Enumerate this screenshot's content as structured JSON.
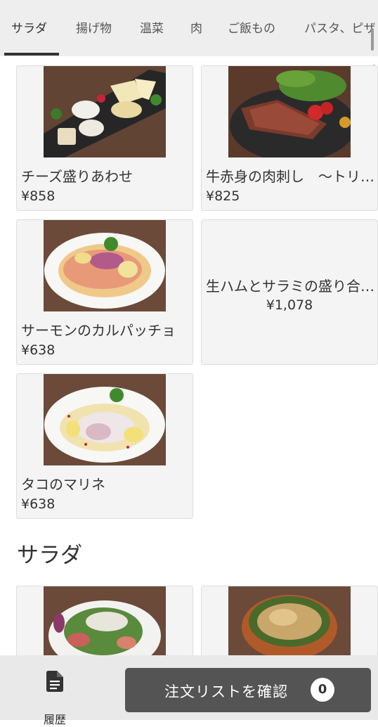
{
  "tabs": [
    {
      "label": "サラダ",
      "active": true
    },
    {
      "label": "揚げ物",
      "active": false
    },
    {
      "label": "温菜",
      "active": false
    },
    {
      "label": "肉",
      "active": false
    },
    {
      "label": "ご飯もの",
      "active": false
    },
    {
      "label": "パスタ、ピザ",
      "active": false
    }
  ],
  "items": [
    {
      "name": "チーズ盛りあわせ",
      "price": "¥858",
      "image": "cheese-plate"
    },
    {
      "name": "牛赤身の肉刺し　〜トリュフソース〜",
      "price": "¥825",
      "image": "beef-tataki"
    },
    {
      "name": "サーモンのカルパッチョ",
      "price": "¥638",
      "image": "salmon-carpaccio"
    },
    {
      "name": "生ハムとサラミの盛り合わせ",
      "price": "¥1,078",
      "image": null
    },
    {
      "name": "タコのマリネ",
      "price": "¥638",
      "image": "octopus-marinade"
    }
  ],
  "section": {
    "title": "サラダ"
  },
  "footer": {
    "history_label": "履歴",
    "order_label": "注文リストを確認",
    "order_count": "0"
  },
  "colors": {
    "tabbar_bg": "#eeeeee",
    "card_bg": "#f4f4f4",
    "order_button": "#545454",
    "footer_bg": "#e9e9e9"
  }
}
